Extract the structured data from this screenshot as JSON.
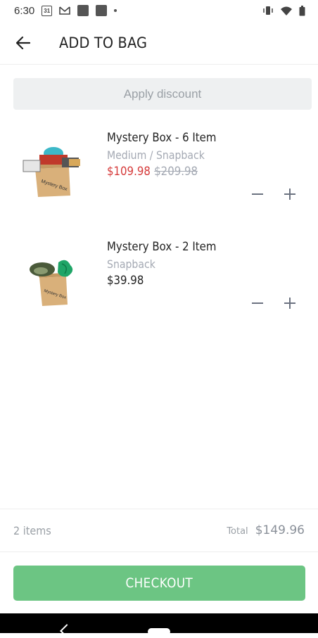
{
  "status_bar": {
    "time": "6:30",
    "calendar_day": "31",
    "icons": [
      "calendar-icon",
      "gmail-icon",
      "app-icon",
      "app-icon",
      "notification-dot",
      "vibrate-icon",
      "wifi-icon",
      "battery-icon"
    ]
  },
  "header": {
    "back_icon": "arrow-left-icon",
    "title": "ADD TO BAG"
  },
  "discount": {
    "label": "Apply discount"
  },
  "cart": {
    "items": [
      {
        "name": "Mystery Box - 6 Item",
        "variant": "Medium / Snapback",
        "sale_price": "$109.98",
        "original_price": "$209.98"
      },
      {
        "name": "Mystery Box - 2 Item",
        "variant": "Snapback",
        "price": "$39.98"
      }
    ]
  },
  "summary": {
    "items_count": "2 items",
    "total_label": "Total",
    "total_value": "$149.96"
  },
  "checkout": {
    "label": "CHECKOUT"
  },
  "colors": {
    "accent_green": "#6cc583",
    "sale_red": "#d63b3b",
    "muted_gray": "#a4a9b3",
    "discount_bg": "#eef0f1"
  }
}
